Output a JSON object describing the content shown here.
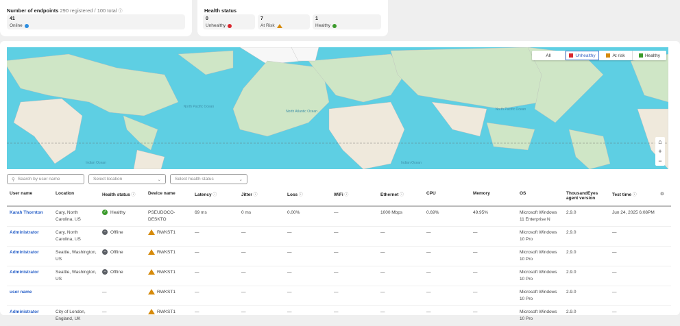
{
  "endpoints": {
    "title": "Number of endpoints",
    "subtitle": "290 registered / 100 total",
    "online_count": "41",
    "online_label": "Online"
  },
  "health": {
    "title": "Health status",
    "unhealthy_count": "0",
    "unhealthy_label": "Unhealthy",
    "atrisk_count": "7",
    "atrisk_label": "At Risk",
    "healthy_count": "1",
    "healthy_label": "Healthy"
  },
  "map": {
    "legend": {
      "all": "All",
      "unhealthy": "Unhealthy",
      "atrisk": "At risk",
      "healthy": "Healthy"
    },
    "ocean_labels": [
      "North Pacific Ocean",
      "North Atlantic Ocean",
      "Indian Ocean"
    ],
    "zoom_in": "+",
    "zoom_out": "−"
  },
  "colors": {
    "unhealthy": "#d9262e",
    "atrisk": "#d68a0a",
    "healthy": "#3a9a2a",
    "link": "#2860c8"
  },
  "filters": {
    "search_placeholder": "Search by user name",
    "location_placeholder": "Select location",
    "health_placeholder": "Select health status"
  },
  "table": {
    "headers": [
      "User name",
      "Location",
      "Health status",
      "Device name",
      "Latency",
      "Jitter",
      "Loss",
      "WiFi",
      "Ethernet",
      "CPU",
      "Memory",
      "OS",
      "ThousandEyes agent version",
      "Test time"
    ],
    "rows": [
      {
        "user": "Karah Thornton",
        "location": "Cary, North Carolina, US",
        "health": "Healthy",
        "device": "PSEUDOCO-DESKTO",
        "latency": "69 ms",
        "jitter": "0 ms",
        "loss": "0.00%",
        "wifi": "—",
        "ethernet": "1000 Mbps",
        "cpu": "0.69%",
        "memory": "49.95%",
        "os": "Microsoft Windows 11 Enterprise N",
        "version": "2.9.0",
        "time": "Jun 24, 2025 6:08PM"
      },
      {
        "user": "Administrator",
        "location": "Cary, North Carolina, US",
        "health": "Offline",
        "device": "RWKST1",
        "latency": "—",
        "jitter": "—",
        "loss": "—",
        "wifi": "—",
        "ethernet": "—",
        "cpu": "—",
        "memory": "—",
        "os": "Microsoft Windows 10 Pro",
        "version": "2.9.0",
        "time": "—"
      },
      {
        "user": "Administrator",
        "location": "Seattle, Washington, US",
        "health": "Offline",
        "device": "RWKST1",
        "latency": "—",
        "jitter": "—",
        "loss": "—",
        "wifi": "—",
        "ethernet": "—",
        "cpu": "—",
        "memory": "—",
        "os": "Microsoft Windows 10 Pro",
        "version": "2.9.0",
        "time": "—"
      },
      {
        "user": "Administrator",
        "location": "Seattle, Washington, US",
        "health": "Offline",
        "device": "RWKST1",
        "latency": "—",
        "jitter": "—",
        "loss": "—",
        "wifi": "—",
        "ethernet": "—",
        "cpu": "—",
        "memory": "—",
        "os": "Microsoft Windows 10 Pro",
        "version": "2.9.0",
        "time": "—"
      },
      {
        "user": "user name",
        "location": "",
        "health": "—",
        "device": "RWKST1",
        "latency": "—",
        "jitter": "—",
        "loss": "—",
        "wifi": "—",
        "ethernet": "—",
        "cpu": "—",
        "memory": "—",
        "os": "Microsoft Windows 10 Pro",
        "version": "2.9.0",
        "time": "—"
      },
      {
        "user": "Administrator",
        "location": "City of London, England, UK",
        "health": "—",
        "device": "RWKST1",
        "latency": "—",
        "jitter": "—",
        "loss": "—",
        "wifi": "—",
        "ethernet": "—",
        "cpu": "—",
        "memory": "—",
        "os": "Microsoft Windows 10 Pro",
        "version": "2.9.0",
        "time": "—"
      }
    ]
  }
}
